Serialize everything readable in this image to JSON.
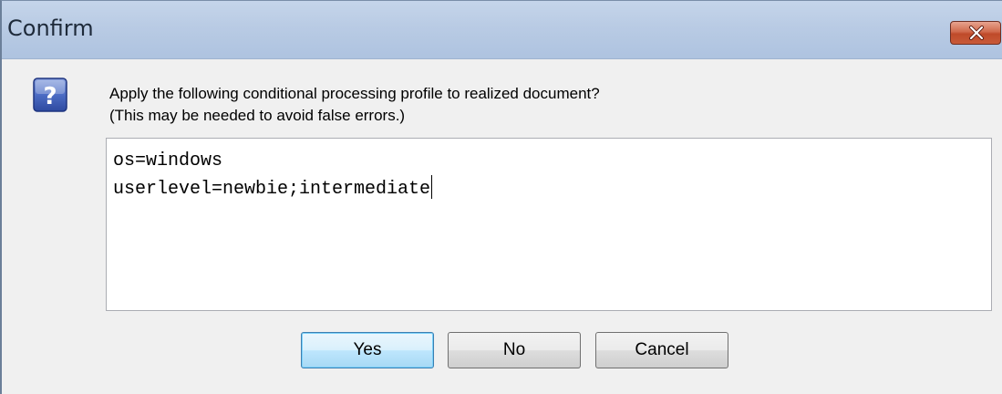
{
  "window": {
    "title": "Confirm",
    "close_icon": "close-icon",
    "close_color": "#c85a38"
  },
  "dialog": {
    "icon": "question-icon",
    "message_lines": [
      "Apply the following conditional processing profile to realized document?",
      "(This may be needed to avoid false errors.)"
    ],
    "profile_lines": [
      "os=windows",
      "userlevel=newbie;intermediate"
    ]
  },
  "buttons": {
    "yes_label": "Yes",
    "no_label": "No",
    "cancel_label": "Cancel",
    "default": "yes"
  }
}
